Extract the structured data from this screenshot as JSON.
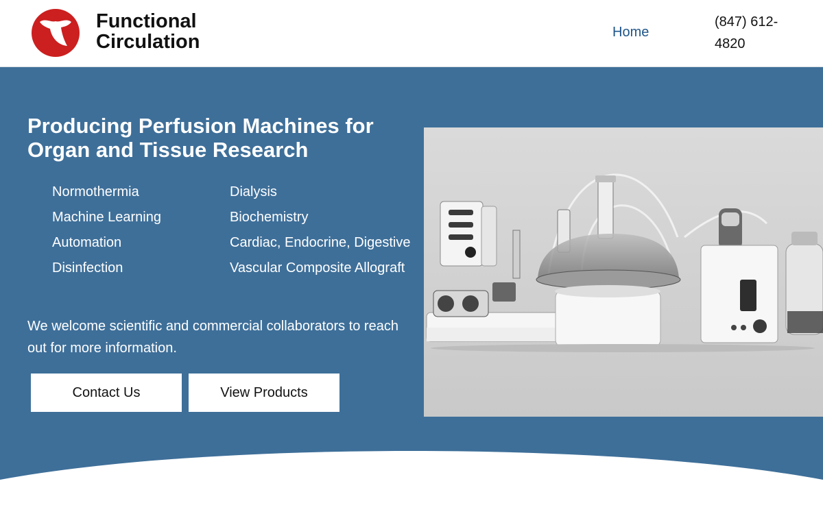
{
  "header": {
    "brand_line1": "Functional",
    "brand_line2": "Circulation",
    "logo_icon": "heart-logo-icon",
    "nav_home": "Home",
    "phone_line1": "(847) 612-",
    "phone_line2": "4820"
  },
  "hero": {
    "title": "Producing Perfusion Machines for Organ and Tissue Research",
    "features_left": [
      "Normothermia",
      "Machine Learning",
      "Automation",
      "Disinfection"
    ],
    "features_right": [
      "Dialysis",
      "Biochemistry",
      "Cardiac, Endocrine, Digestive",
      "Vascular Composite Allograft"
    ],
    "welcome": "We welcome scientific and commercial collaborators to reach out for more information.",
    "contact_button": "Contact Us",
    "products_button": "View Products"
  },
  "colors": {
    "hero_background": "#3e6f99",
    "nav_link": "#1f5588",
    "logo_red": "#cc1f1f"
  }
}
